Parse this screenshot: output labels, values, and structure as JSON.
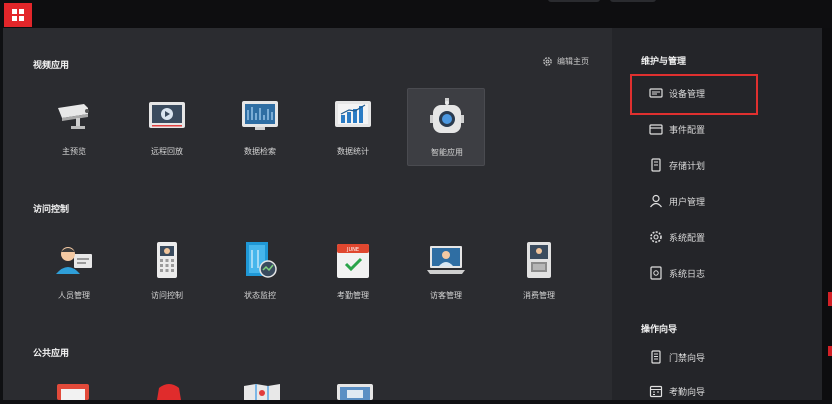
{
  "main": {
    "edit_home_label": "编辑主页",
    "sections": [
      {
        "title": "视频应用",
        "items": [
          "主预览",
          "远程回放",
          "数据检索",
          "数据统计",
          "智能应用"
        ]
      },
      {
        "title": "访问控制",
        "items": [
          "人员管理",
          "访问控制",
          "状态监控",
          "考勤管理",
          "访客管理",
          "消费管理"
        ]
      },
      {
        "title": "公共应用",
        "items": []
      }
    ]
  },
  "sidebar": {
    "maintenance_title": "维护与管理",
    "maintenance_items": [
      "设备管理",
      "事件配置",
      "存储计划",
      "用户管理",
      "系统配置",
      "系统日志"
    ],
    "wizard_title": "操作向导",
    "wizard_items": [
      "门禁向导",
      "考勤向导"
    ]
  },
  "attendance_icon_text": "JUNE",
  "colors": {
    "brand_red": "#e3262a",
    "highlight_red": "#e0302f",
    "panel": "#2b2c30",
    "sidebar": "#242529"
  }
}
